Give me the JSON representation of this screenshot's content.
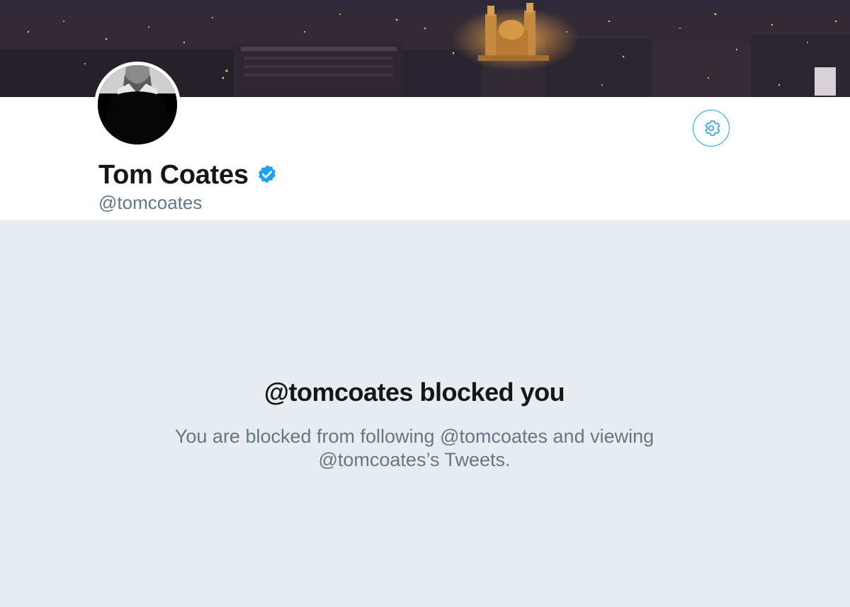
{
  "profile": {
    "display_name": "Tom Coates",
    "handle": "@tomcoates",
    "verified": true
  },
  "header": {
    "banner_icon": "city-night-banner",
    "settings_icon": "gear-icon"
  },
  "blocked": {
    "title": "@tomcoates blocked you",
    "description": "You are blocked from following @tomcoates and viewing @tomcoates’s Tweets."
  },
  "colors": {
    "accent": "#1da1f2",
    "text_primary": "#14171a",
    "text_secondary": "#657786",
    "background": "#e6ecf0"
  }
}
